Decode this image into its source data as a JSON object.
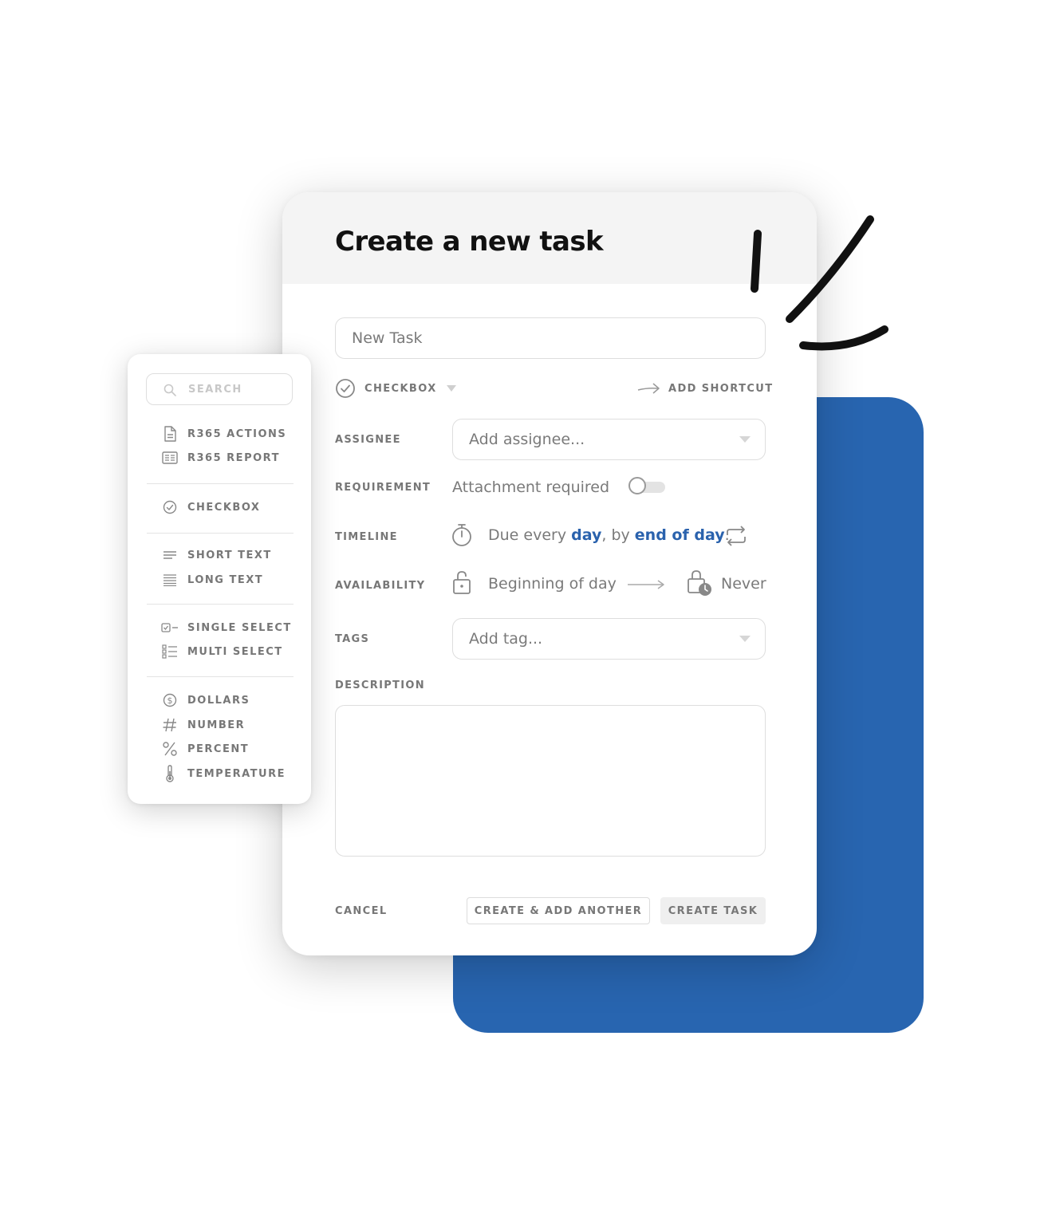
{
  "modal": {
    "title": "Create a new task",
    "task_name_value": "New Task",
    "type": {
      "label": "CHECKBOX",
      "icon": "check-circle-icon"
    },
    "shortcut": {
      "label": "ADD SHORTCUT",
      "icon": "arrow-right-icon"
    },
    "assignee": {
      "label": "ASSIGNEE",
      "placeholder": "Add assignee..."
    },
    "requirement": {
      "label": "REQUIREMENT",
      "text": "Attachment required",
      "toggle_on": false
    },
    "timeline": {
      "label": "TIMELINE",
      "prefix": "Due every ",
      "frequency": "day",
      "middle": ", by ",
      "deadline": "end of day",
      "suffix": "."
    },
    "availability": {
      "label": "AVAILABILITY",
      "start": "Beginning of day",
      "end": "Never"
    },
    "tags": {
      "label": "TAGS",
      "placeholder": "Add tag..."
    },
    "description": {
      "label": "DESCRIPTION",
      "value": ""
    },
    "buttons": {
      "cancel": "CANCEL",
      "create_another": "CREATE & ADD ANOTHER",
      "create": "CREATE TASK"
    }
  },
  "palette": {
    "search_placeholder": "SEARCH",
    "groups": [
      [
        {
          "label": "R365 ACTIONS",
          "icon": "document-icon"
        },
        {
          "label": "R365 REPORT",
          "icon": "report-icon"
        }
      ],
      [
        {
          "label": "CHECKBOX",
          "icon": "check-circle-icon"
        }
      ],
      [
        {
          "label": "SHORT TEXT",
          "icon": "short-text-icon"
        },
        {
          "label": "LONG TEXT",
          "icon": "long-text-icon"
        }
      ],
      [
        {
          "label": "SINGLE SELECT",
          "icon": "single-select-icon"
        },
        {
          "label": "MULTI SELECT",
          "icon": "multi-select-icon"
        }
      ],
      [
        {
          "label": "DOLLARS",
          "icon": "dollar-icon"
        },
        {
          "label": "NUMBER",
          "icon": "hash-icon"
        },
        {
          "label": "PERCENT",
          "icon": "percent-icon"
        },
        {
          "label": "TEMPERATURE",
          "icon": "thermometer-icon"
        }
      ]
    ]
  },
  "colors": {
    "accent_blue": "#2865b0",
    "link_blue": "#2a62ad",
    "header_bg": "#f4f4f4"
  }
}
